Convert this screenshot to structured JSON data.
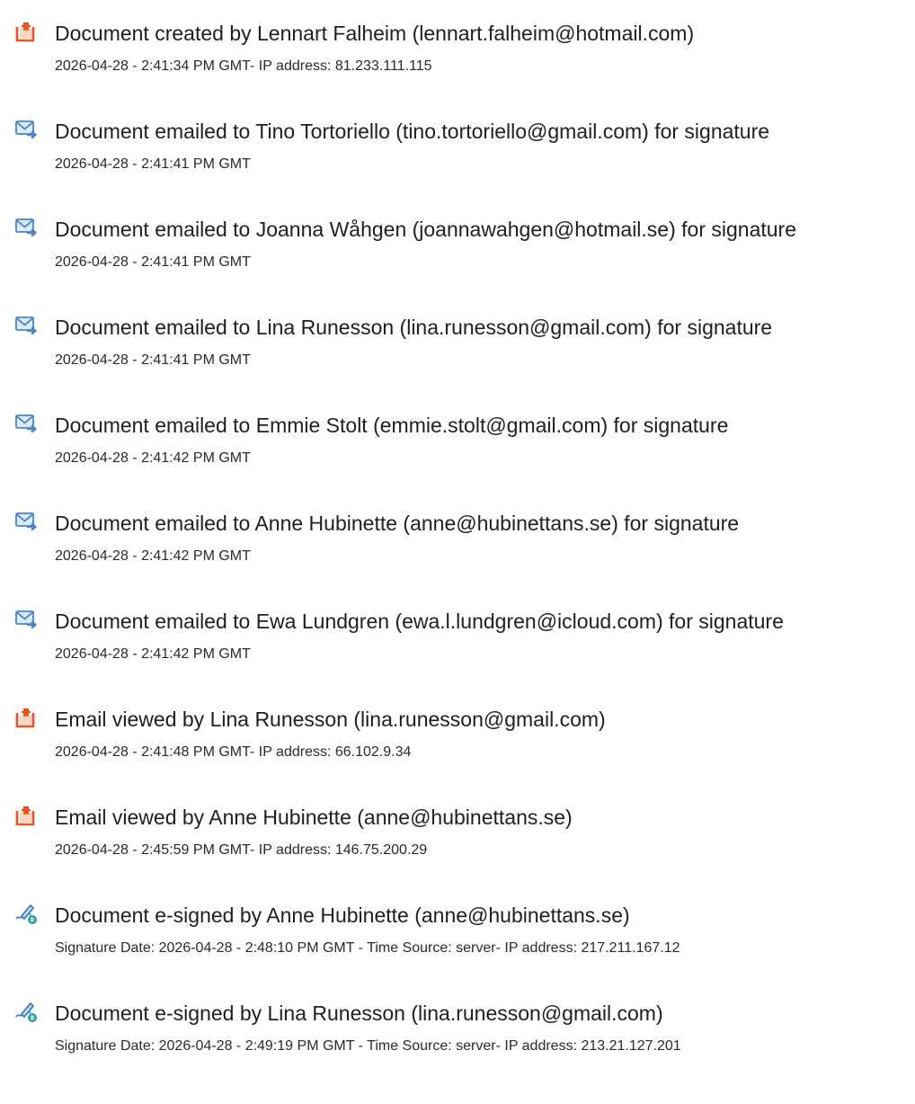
{
  "entries": [
    {
      "icon": "document-created-icon",
      "title": "Document created by Lennart Falheim (lennart.falheim@hotmail.com)",
      "detail": "2026-04-28 - 2:41:34 PM GMT- IP address: 81.233.111.115"
    },
    {
      "icon": "email-sent-icon",
      "title": "Document emailed to Tino Tortoriello (tino.tortoriello@gmail.com) for signature",
      "detail": "2026-04-28 - 2:41:41 PM GMT"
    },
    {
      "icon": "email-sent-icon",
      "title": "Document emailed to Joanna Wåhgen (joannawahgen@hotmail.se) for signature",
      "detail": "2026-04-28 - 2:41:41 PM GMT"
    },
    {
      "icon": "email-sent-icon",
      "title": "Document emailed to Lina Runesson (lina.runesson@gmail.com) for signature",
      "detail": "2026-04-28 - 2:41:41 PM GMT"
    },
    {
      "icon": "email-sent-icon",
      "title": "Document emailed to Emmie Stolt (emmie.stolt@gmail.com) for signature",
      "detail": "2026-04-28 - 2:41:42 PM GMT"
    },
    {
      "icon": "email-sent-icon",
      "title": "Document emailed to Anne Hubinette (anne@hubinettans.se) for signature",
      "detail": "2026-04-28 - 2:41:42 PM GMT"
    },
    {
      "icon": "email-sent-icon",
      "title": "Document emailed to Ewa Lundgren (ewa.l.lundgren@icloud.com) for signature",
      "detail": "2026-04-28 - 2:41:42 PM GMT"
    },
    {
      "icon": "document-viewed-icon",
      "title": "Email viewed by Lina Runesson (lina.runesson@gmail.com)",
      "detail": "2026-04-28 - 2:41:48 PM GMT- IP address: 66.102.9.34"
    },
    {
      "icon": "document-viewed-icon",
      "title": "Email viewed by Anne Hubinette (anne@hubinettans.se)",
      "detail": "2026-04-28 - 2:45:59 PM GMT- IP address: 146.75.200.29"
    },
    {
      "icon": "e-signed-icon",
      "title": "Document e-signed by Anne Hubinette (anne@hubinettans.se)",
      "detail": "Signature Date: 2026-04-28 - 2:48:10 PM GMT - Time Source: server- IP address: 217.211.167.12"
    },
    {
      "icon": "e-signed-icon",
      "title": "Document e-signed by Lina Runesson (lina.runesson@gmail.com)",
      "detail": "Signature Date: 2026-04-28 - 2:49:19 PM GMT - Time Source: server- IP address: 213.21.127.201"
    }
  ],
  "colors": {
    "document_icon": "#e8531f",
    "email_icon": "#4a86c8",
    "esign_icon": "#3f7fc4",
    "esign_badge": "#2aa39a"
  }
}
